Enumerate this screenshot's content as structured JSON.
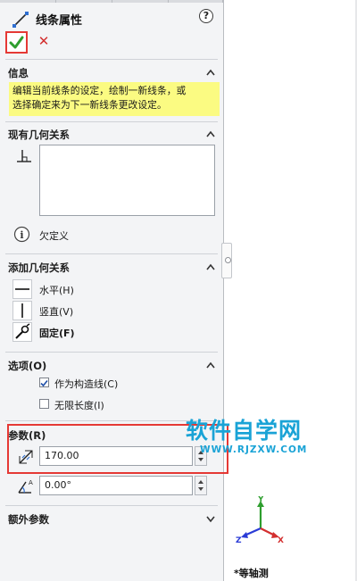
{
  "header": {
    "title": "线条属性",
    "help_icon": "help-icon",
    "help_glyph": "?"
  },
  "actions": {
    "ok_icon": "checkmark-icon",
    "cancel_icon": "close-icon",
    "cancel_glyph": "✕",
    "ok_color": "#2e9e2e",
    "cancel_color": "#d32f2f",
    "highlight_color": "#e53935"
  },
  "info": {
    "title": "信息",
    "message_line1": "编辑当前线条的设定，绘制一新线条，或",
    "message_line2": "选择确定来为下一新线条更改设定。",
    "background": "#fbfb82"
  },
  "existing_relations": {
    "title": "现有几何关系",
    "items": [],
    "status_icon": "info-icon",
    "status_glyph": "i",
    "status_text": "欠定义"
  },
  "add_relations": {
    "title": "添加几何关系",
    "items": [
      {
        "label": "水平(H)",
        "icon": "horizontal-relation-icon"
      },
      {
        "label": "竖直(V)",
        "icon": "vertical-relation-icon"
      },
      {
        "label": "固定(F)",
        "icon": "fix-relation-icon"
      }
    ]
  },
  "options": {
    "title": "选项(O)",
    "construction": {
      "label": "作为构造线(C)",
      "checked": true
    },
    "infinite": {
      "label": "无限长度(I)",
      "checked": false
    }
  },
  "parameters": {
    "title": "参数(R)",
    "length_value": "170.00",
    "angle_value": "0.00°"
  },
  "extra_params": {
    "title": "额外参数"
  },
  "watermark": {
    "title": "软件自学网",
    "url": "WWW.RJZXW.COM",
    "color": "#1aa3d6"
  },
  "view": {
    "label": "*等轴测",
    "axes": [
      "Y",
      "Z",
      "X"
    ],
    "axis_colors": [
      "#2e9e2e",
      "#2a3bd6",
      "#d32f2f"
    ]
  }
}
